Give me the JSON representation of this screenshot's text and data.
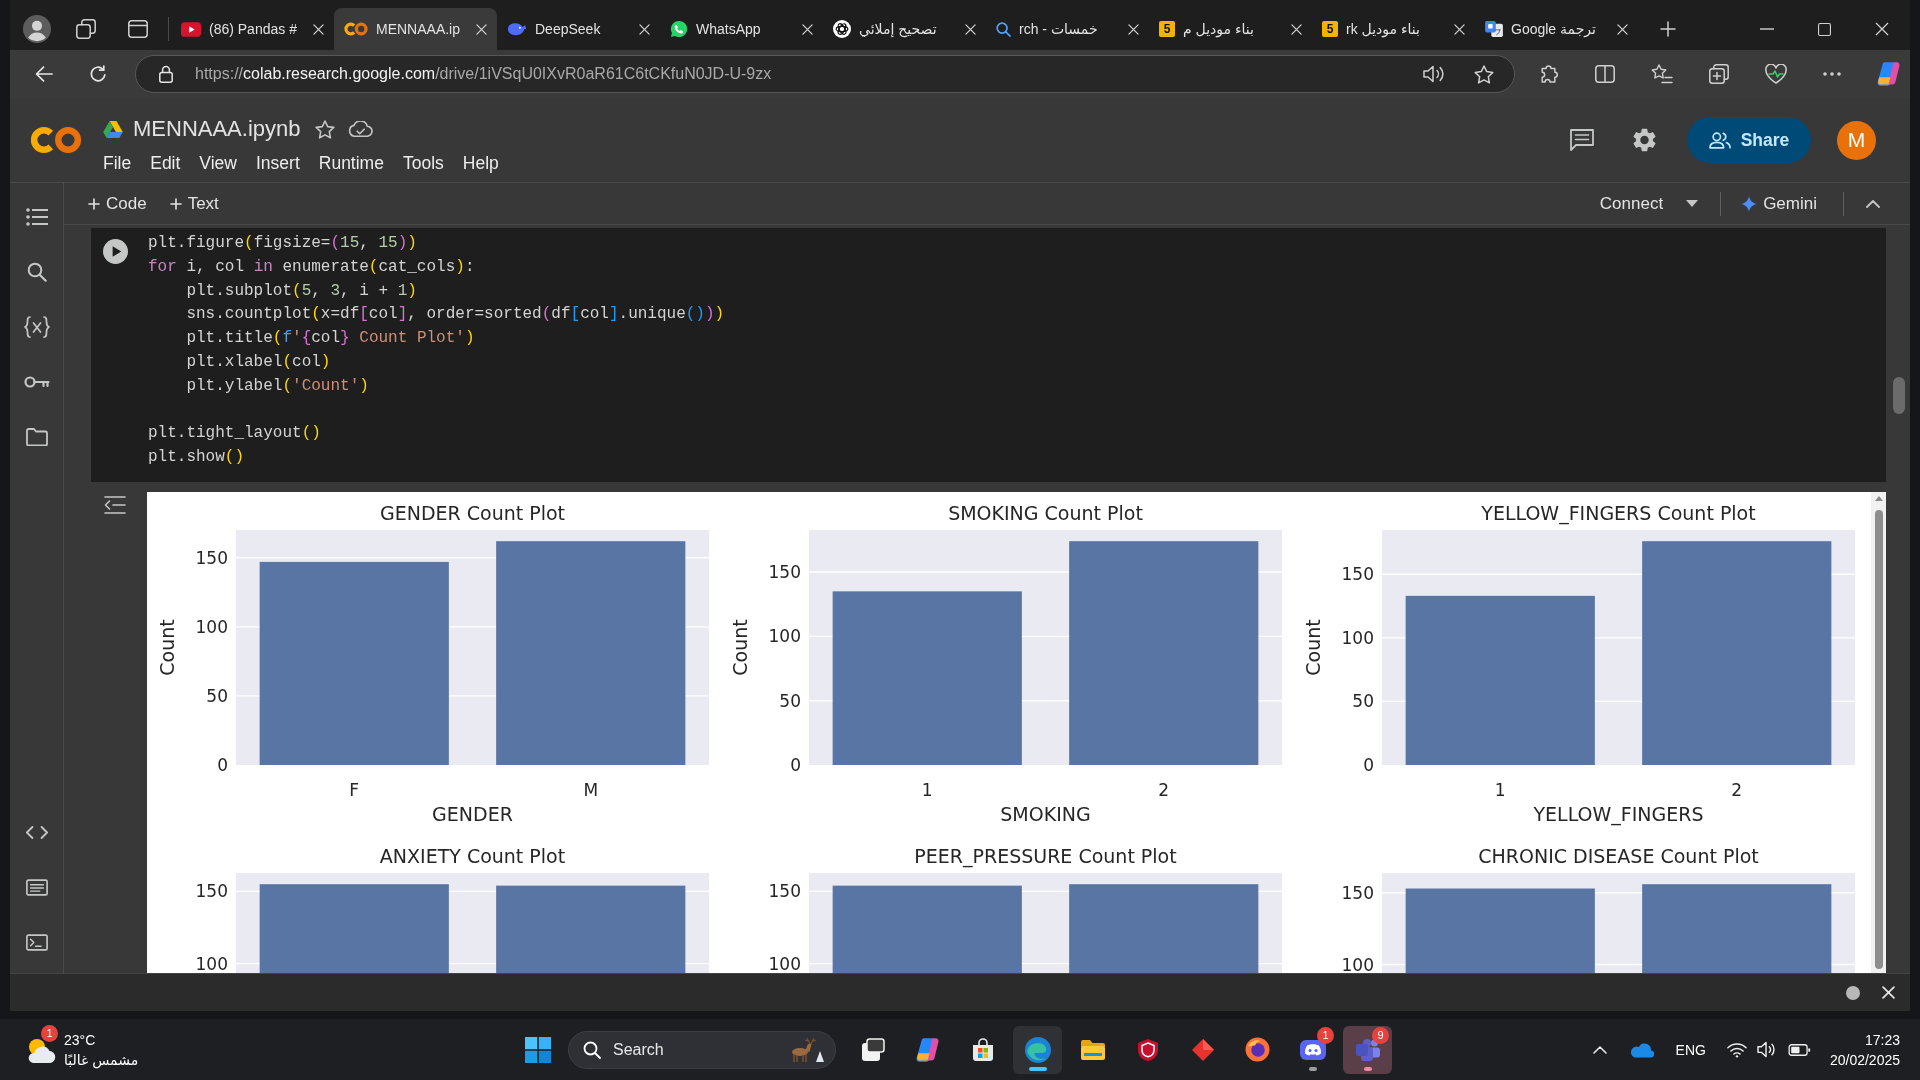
{
  "browser": {
    "tabs": [
      {
        "label": "(86) Pandas #",
        "selected": false
      },
      {
        "label": "MENNAAA.ip",
        "selected": true
      },
      {
        "label": "DeepSeek",
        "selected": false
      },
      {
        "label": "WhatsApp",
        "selected": false
      },
      {
        "label": "تصحيح إملائي",
        "selected": false
      },
      {
        "label": "خمسات - rch",
        "selected": false
      },
      {
        "label": "بناء موديل م",
        "favicon_text": "5",
        "selected": false
      },
      {
        "label": "بناء موديل rk",
        "favicon_text": "5",
        "selected": false
      },
      {
        "label": "ترجمة Google",
        "selected": false
      }
    ],
    "address": {
      "scheme": "https://",
      "host": "colab.research.google.com",
      "path": "/drive/1iVSqU0IXvR0aR61C6tCKfuN0JD-U-9zx"
    }
  },
  "notebook": {
    "title": "MENNAAA.ipynb",
    "menu": [
      "File",
      "Edit",
      "View",
      "Insert",
      "Runtime",
      "Tools",
      "Help"
    ],
    "share": "Share",
    "avatar": "M",
    "toolbar": {
      "add": [
        "Code",
        "Text"
      ],
      "connect": "Connect",
      "assistant": "Gemini"
    },
    "code_cell": {
      "blocks": [
        [
          [
            {
              "text": "plt.figure",
              "kind": "plain"
            },
            {
              "text": "(",
              "kind": "bracket1"
            },
            {
              "text": "figsize=",
              "kind": "plain"
            },
            {
              "text": "(",
              "kind": "bracket2"
            },
            {
              "text": "15",
              "kind": "number"
            },
            {
              "text": ", ",
              "kind": "plain"
            },
            {
              "text": "15",
              "kind": "number"
            },
            {
              "text": ")",
              "kind": "bracket2"
            },
            {
              "text": ")",
              "kind": "bracket1"
            }
          ],
          [
            {
              "text": "for",
              "kind": "keyword"
            },
            {
              "text": " i, col ",
              "kind": "plain"
            },
            {
              "text": "in",
              "kind": "keyword"
            },
            {
              "text": " enumerate",
              "kind": "plain"
            },
            {
              "text": "(",
              "kind": "bracket1"
            },
            {
              "text": "cat_cols",
              "kind": "plain"
            },
            {
              "text": ")",
              "kind": "bracket1"
            },
            {
              "text": ":",
              "kind": "plain"
            }
          ],
          [
            {
              "text": "    plt.subplot",
              "kind": "plain"
            },
            {
              "text": "(",
              "kind": "bracket1"
            },
            {
              "text": "5",
              "kind": "number"
            },
            {
              "text": ", ",
              "kind": "plain"
            },
            {
              "text": "3",
              "kind": "number"
            },
            {
              "text": ", i + ",
              "kind": "plain"
            },
            {
              "text": "1",
              "kind": "number"
            },
            {
              "text": ")",
              "kind": "bracket1"
            }
          ],
          [
            {
              "text": "    sns.countplot",
              "kind": "plain"
            },
            {
              "text": "(",
              "kind": "bracket1"
            },
            {
              "text": "x=df",
              "kind": "plain"
            },
            {
              "text": "[",
              "kind": "bracket2"
            },
            {
              "text": "col",
              "kind": "plain"
            },
            {
              "text": "]",
              "kind": "bracket2"
            },
            {
              "text": ", order=sorted",
              "kind": "plain"
            },
            {
              "text": "(",
              "kind": "bracket2"
            },
            {
              "text": "df",
              "kind": "plain"
            },
            {
              "text": "[",
              "kind": "bracket3"
            },
            {
              "text": "col",
              "kind": "plain"
            },
            {
              "text": "]",
              "kind": "bracket3"
            },
            {
              "text": ".unique",
              "kind": "plain"
            },
            {
              "text": "()",
              "kind": "bracket3"
            },
            {
              "text": ")",
              "kind": "bracket2"
            },
            {
              "text": ")",
              "kind": "bracket1"
            }
          ],
          [
            {
              "text": "    plt.title",
              "kind": "plain"
            },
            {
              "text": "(",
              "kind": "bracket1"
            },
            {
              "text": "f",
              "kind": "prefix"
            },
            {
              "text": "'",
              "kind": "string"
            },
            {
              "text": "{",
              "kind": "bracket2"
            },
            {
              "text": "col",
              "kind": "plain"
            },
            {
              "text": "}",
              "kind": "bracket2"
            },
            {
              "text": " Count Plot'",
              "kind": "string"
            },
            {
              "text": ")",
              "kind": "bracket1"
            }
          ],
          [
            {
              "text": "    plt.xlabel",
              "kind": "plain"
            },
            {
              "text": "(",
              "kind": "bracket1"
            },
            {
              "text": "col",
              "kind": "plain"
            },
            {
              "text": ")",
              "kind": "bracket1"
            }
          ],
          [
            {
              "text": "    plt.ylabel",
              "kind": "plain"
            },
            {
              "text": "(",
              "kind": "bracket1"
            },
            {
              "text": "'Count'",
              "kind": "string"
            },
            {
              "text": ")",
              "kind": "bracket1"
            }
          ]
        ],
        [
          [
            {
              "text": "plt.tight_layout",
              "kind": "plain"
            },
            {
              "text": "()",
              "kind": "bracket1"
            }
          ],
          [
            {
              "text": "plt.show",
              "kind": "plain"
            },
            {
              "text": "()",
              "kind": "bracket1"
            }
          ]
        ]
      ]
    },
    "output": {
      "charts": [
        {
          "chart_data": {
            "type": "bar",
            "title": "GENDER Count Plot",
            "xlabel": "GENDER",
            "ylabel": "Count",
            "categories": [
              "F",
              "M"
            ],
            "values": [
              147,
              162
            ],
            "ylim": [
              0,
              170.1
            ],
            "yticks": [
              0,
              50,
              100,
              150
            ],
            "grid": true
          }
        },
        {
          "chart_data": {
            "type": "bar",
            "title": "SMOKING Count Plot",
            "xlabel": "SMOKING",
            "ylabel": "Count",
            "categories": [
              "1",
              "2"
            ],
            "values": [
              135,
              174
            ],
            "ylim": [
              0,
              182.7
            ],
            "yticks": [
              0,
              50,
              100,
              150
            ],
            "grid": true
          }
        },
        {
          "chart_data": {
            "type": "bar",
            "title": "YELLOW_FINGERS Count Plot",
            "xlabel": "YELLOW_FINGERS",
            "ylabel": "Count",
            "categories": [
              "1",
              "2"
            ],
            "values": [
              133,
              176
            ],
            "ylim": [
              0,
              184.8
            ],
            "yticks": [
              0,
              50,
              100,
              150
            ],
            "grid": true
          }
        },
        {
          "chart_data": {
            "type": "bar",
            "title": "ANXIETY Count Plot",
            "values": [
              155,
              154
            ],
            "ylim": [
              93.5,
              162.75
            ],
            "yticks": [
              100,
              150
            ],
            "grid": true
          }
        },
        {
          "chart_data": {
            "type": "bar",
            "title": "PEER_PRESSURE Count Plot",
            "values": [
              154,
              155
            ],
            "ylim": [
              93.5,
              162.75
            ],
            "yticks": [
              100,
              150
            ],
            "grid": true
          }
        },
        {
          "chart_data": {
            "type": "bar",
            "title": "CHRONIC DISEASE Count Plot",
            "values": [
              153,
              156
            ],
            "ylim": [
              94.1,
              163.8
            ],
            "yticks": [
              100,
              150
            ],
            "grid": true
          }
        }
      ]
    }
  },
  "taskbar": {
    "weather": {
      "badge": "1",
      "temperature": "23°C",
      "condition": "مشمس غالبًا"
    },
    "search": {
      "placeholder": "Search"
    },
    "apps": [
      {
        "running": false,
        "selected": false,
        "flashing": false
      },
      {
        "running": false,
        "selected": false,
        "flashing": false
      },
      {
        "running": false,
        "selected": false,
        "flashing": false
      },
      {
        "running": true,
        "selected": true,
        "flashing": false
      },
      {
        "running": false,
        "selected": false,
        "flashing": false
      },
      {
        "running": false,
        "selected": false,
        "flashing": false
      },
      {
        "running": false,
        "selected": false,
        "flashing": false
      },
      {
        "running": false,
        "selected": false,
        "flashing": false
      },
      {
        "running": true,
        "selected": false,
        "flashing": false,
        "badge": "1"
      },
      {
        "running": true,
        "selected": false,
        "flashing": true,
        "badge": "9"
      }
    ],
    "language": "ENG",
    "time": "17:23",
    "date": "20/02/2025"
  }
}
